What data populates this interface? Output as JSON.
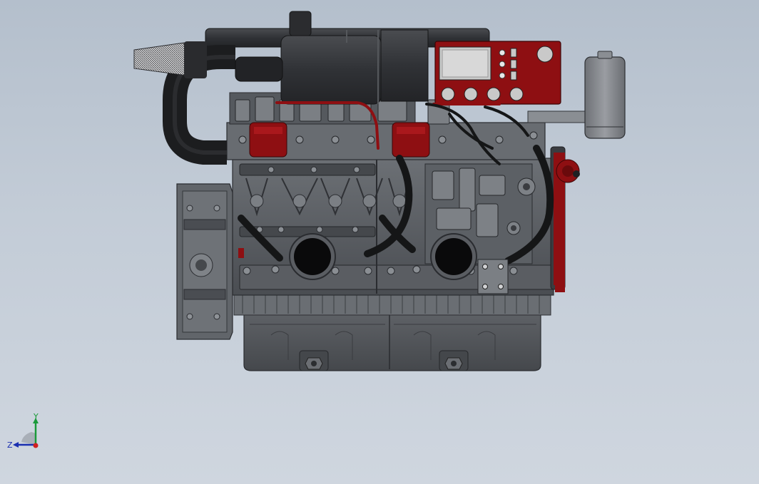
{
  "scene": {
    "name": "engine-assembly-front-view",
    "colors": {
      "background_top": "#b4bfcc",
      "background_bottom": "#cfd6df",
      "body": "#5d6065",
      "body_dark": "#3c3f44",
      "body_light": "#8a8e94",
      "rubber": "#1b1c1e",
      "accent_red": "#8e0f12",
      "panel_screen": "#c9c9c9",
      "silver": "#a9acb0"
    }
  },
  "triad": {
    "x_label": "",
    "y_label": "Y",
    "z_label": "Z",
    "colors": {
      "x": "#d02020",
      "y": "#1a9a3a",
      "z": "#1a2fb0"
    }
  }
}
